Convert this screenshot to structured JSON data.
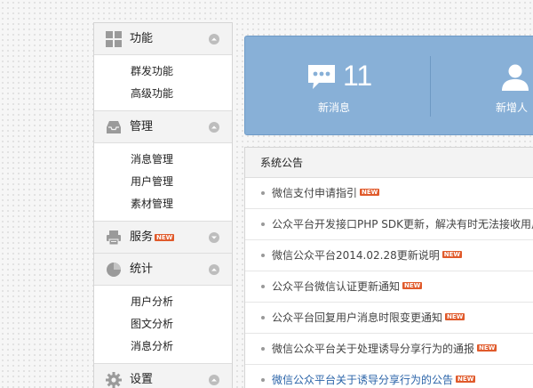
{
  "sidebar": {
    "sections": [
      {
        "title": "功能",
        "icon": "grid-icon",
        "items": [
          "群发功能",
          "高级功能"
        ],
        "new": false,
        "expanded": true
      },
      {
        "title": "管理",
        "icon": "inbox-icon",
        "items": [
          "消息管理",
          "用户管理",
          "素材管理"
        ],
        "new": false,
        "expanded": true
      },
      {
        "title": "服务",
        "icon": "printer-icon",
        "items": [],
        "new": true,
        "expanded": false
      },
      {
        "title": "统计",
        "icon": "pie-chart-icon",
        "items": [
          "用户分析",
          "图文分析",
          "消息分析"
        ],
        "new": false,
        "expanded": true
      },
      {
        "title": "设置",
        "icon": "gear-icon",
        "items": [],
        "new": false,
        "expanded": true
      }
    ]
  },
  "badge_text": "NEW",
  "stats": {
    "new_messages": {
      "value": "11",
      "label": "新消息"
    },
    "new_users": {
      "label": "新增人"
    }
  },
  "notice": {
    "title": "系统公告",
    "items": [
      {
        "text": "微信支付申请指引",
        "new": true
      },
      {
        "text": "公众平台开发接口PHP SDK更新，解决有时无法接收用户",
        "new": false
      },
      {
        "text": "微信公众平台2014.02.28更新说明",
        "new": true
      },
      {
        "text": "公众平台微信认证更新通知",
        "new": true
      },
      {
        "text": "公众平台回复用户消息时限变更通知",
        "new": true
      },
      {
        "text": "微信公众平台关于处理诱导分享行为的通报",
        "new": true
      },
      {
        "text": "微信公众平台关于诱导分享行为的公告",
        "new": true,
        "link": true
      }
    ]
  },
  "colors": {
    "banner": "#88b0d7",
    "badge": "#e05a2b",
    "link": "#2a63a8"
  }
}
